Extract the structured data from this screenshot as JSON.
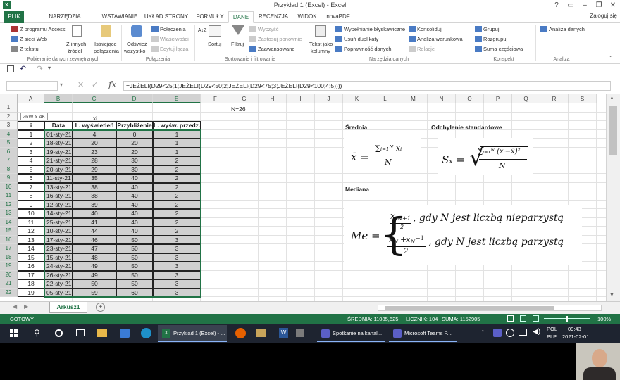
{
  "window": {
    "title": "Przykład 1 (Excel) - Excel",
    "help": "?"
  },
  "ribbon_tabs": [
    "PLIK",
    "NARZĘDZIA GŁÓWNE",
    "WSTAWIANIE",
    "UKŁAD STRONY",
    "FORMUŁY",
    "DANE",
    "RECENZJA",
    "WIDOK",
    "novaPDF"
  ],
  "active_tab": "DANE",
  "user": "Zaloguj się",
  "ribbon": {
    "external": {
      "items": [
        "Z programu Access",
        "Z sieci Web",
        "Z tekstu"
      ],
      "other_sources": [
        "Z innych",
        "źródeł"
      ],
      "existing": [
        "Istniejące",
        "połączenia"
      ],
      "label": "Pobieranie danych zewnętrznych"
    },
    "connections": {
      "refresh": [
        "Odśwież",
        "wszystko"
      ],
      "items": [
        "Połączenia",
        "Właściwości",
        "Edytuj łącza"
      ],
      "label": "Połączenia"
    },
    "sort": {
      "az": "A↓Z",
      "sort": "Sortuj",
      "filter": "Filtruj",
      "items": [
        "Wyczyść",
        "Zastosuj ponownie",
        "Zaawansowane"
      ],
      "label": "Sortowanie i filtrowanie"
    },
    "tools": {
      "text_to_cols": [
        "Tekst jako",
        "kolumny"
      ],
      "col1": [
        "Wypełnianie błyskawiczne",
        "Usuń duplikaty",
        "Poprawność danych"
      ],
      "col2": [
        "Konsoliduj",
        "Analiza warunkowa",
        "Relacje"
      ],
      "label": "Narzędzia danych"
    },
    "outline": {
      "items": [
        "Grupuj",
        "Rozgrupuj",
        "Suma częściowa"
      ],
      "label": "Konspekt"
    },
    "analysis": {
      "items": [
        "Analiza danych"
      ],
      "label": "Analiza"
    }
  },
  "formula_bar": {
    "name_box": "",
    "formula": "=JEŻELI(D29<25;1;JEŻELI(D29<50;2;JEŻELI(D29<75;3;JEŻELI(D29<100;4;5))))"
  },
  "columns": [
    "A",
    "B",
    "C",
    "D",
    "E",
    "F",
    "G",
    "H",
    "I",
    "J",
    "K",
    "L",
    "M",
    "N",
    "O",
    "P",
    "Q",
    "R",
    "S"
  ],
  "rows": [
    "1",
    "2",
    "3",
    "4",
    "5",
    "6",
    "7",
    "8",
    "9",
    "10",
    "11",
    "12",
    "13",
    "14",
    "15",
    "16",
    "17",
    "18",
    "19",
    "20",
    "21",
    "22"
  ],
  "sheet": {
    "n_label": "N=26",
    "tooltip": "26W x 4K",
    "xi": "xi",
    "headers": [
      "i",
      "Data",
      "L. wyświetleń",
      "Przybliżenie",
      "L. wyśw. przedz."
    ],
    "table": [
      [
        "1",
        "01-sty-21",
        "4",
        "0",
        "1"
      ],
      [
        "2",
        "18-sty-21",
        "20",
        "20",
        "1"
      ],
      [
        "3",
        "19-sty-21",
        "23",
        "20",
        "1"
      ],
      [
        "4",
        "21-sty-21",
        "28",
        "30",
        "2"
      ],
      [
        "5",
        "20-sty-21",
        "29",
        "30",
        "2"
      ],
      [
        "6",
        "11-sty-21",
        "35",
        "40",
        "2"
      ],
      [
        "7",
        "13-sty-21",
        "38",
        "40",
        "2"
      ],
      [
        "8",
        "16-sty-21",
        "38",
        "40",
        "2"
      ],
      [
        "9",
        "12-sty-21",
        "39",
        "40",
        "2"
      ],
      [
        "10",
        "14-sty-21",
        "40",
        "40",
        "2"
      ],
      [
        "11",
        "25-sty-21",
        "41",
        "40",
        "2"
      ],
      [
        "12",
        "10-sty-21",
        "44",
        "40",
        "2"
      ],
      [
        "13",
        "17-sty-21",
        "46",
        "50",
        "3"
      ],
      [
        "14",
        "23-sty-21",
        "47",
        "50",
        "3"
      ],
      [
        "15",
        "15-sty-21",
        "48",
        "50",
        "3"
      ],
      [
        "16",
        "24-sty-21",
        "49",
        "50",
        "3"
      ],
      [
        "17",
        "26-sty-21",
        "49",
        "50",
        "3"
      ],
      [
        "18",
        "22-sty-21",
        "50",
        "50",
        "3"
      ],
      [
        "19",
        "05-sty-21",
        "59",
        "60",
        "3"
      ]
    ],
    "srednia": "Średnia",
    "odchylenie": "Odchylenie standardowe",
    "mediana": "Mediana",
    "mean_formula": {
      "lhs": "x̄ =",
      "num": "∑ᵢ₌₁ᴺ xᵢ",
      "den": "N"
    },
    "std_formula": {
      "lhs": "Sₓ =",
      "num": "∑ᵢ₌₁ᴺ (xᵢ−x̄)²",
      "den": "N"
    },
    "median_formula": {
      "lhs": "Me =",
      "case1": ", gdy N jest liczbą nieparzystą",
      "case2": ", gdy N jest liczbą parzystą",
      "c1_num": "x",
      "c1_sub": "N+1",
      "c1_den": "2",
      "c2_num": "x",
      "c2_sub1": "N",
      "c2_sub2": "N",
      "c2_den": "2"
    }
  },
  "sheet_tabs": [
    "Arkusz1"
  ],
  "status": {
    "mode": "GOTOWY",
    "avg": "ŚREDNIA: 11085,625",
    "count": "LICZNIK: 104",
    "sum": "SUMA: 1152905",
    "zoom": "100%"
  },
  "taskbar": {
    "excel": "Przykład 1 (Excel) - ...",
    "teams1": "Spotkanie na kanal...",
    "teams2": "Microsoft Teams P...",
    "lang1": "POL",
    "lang2": "PLP",
    "time": "09:43",
    "date": "2021-02-01"
  }
}
